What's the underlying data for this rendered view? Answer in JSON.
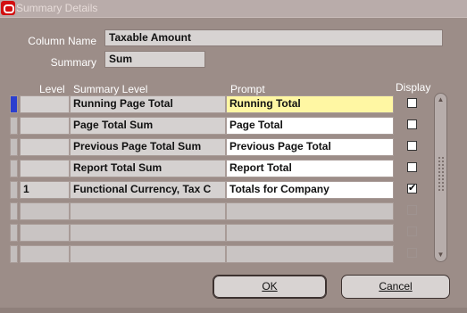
{
  "window": {
    "title": "Summary Details"
  },
  "form": {
    "column_name_label": "Column Name",
    "column_name_value": "Taxable Amount",
    "summary_label": "Summary",
    "summary_value": "Sum"
  },
  "table": {
    "headers": {
      "level": "Level",
      "summary_level": "Summary Level",
      "prompt": "Prompt",
      "display": "Display"
    },
    "rows": [
      {
        "level": "",
        "summary_level": "Running Page Total",
        "prompt": "Running Total",
        "display": false,
        "active": true
      },
      {
        "level": "",
        "summary_level": "Page Total Sum",
        "prompt": "Page Total",
        "display": false
      },
      {
        "level": "",
        "summary_level": "Previous Page Total Sum",
        "prompt": "Previous Page Total",
        "display": false
      },
      {
        "level": "",
        "summary_level": "Report Total Sum",
        "prompt": "Report Total",
        "display": false
      },
      {
        "level": "1",
        "summary_level": "Functional Currency, Tax C",
        "prompt": "Totals for Company",
        "display": true
      },
      {
        "level": "",
        "summary_level": "",
        "prompt": "",
        "display": false,
        "empty": true
      },
      {
        "level": "",
        "summary_level": "",
        "prompt": "",
        "display": false,
        "empty": true
      },
      {
        "level": "",
        "summary_level": "",
        "prompt": "",
        "display": false,
        "empty": true
      }
    ]
  },
  "buttons": {
    "ok": "OK",
    "cancel": "Cancel"
  },
  "icons": {
    "app": "oracle-forms-icon",
    "scroll_up": "scroll-up-icon",
    "scroll_down": "scroll-down-icon"
  }
}
